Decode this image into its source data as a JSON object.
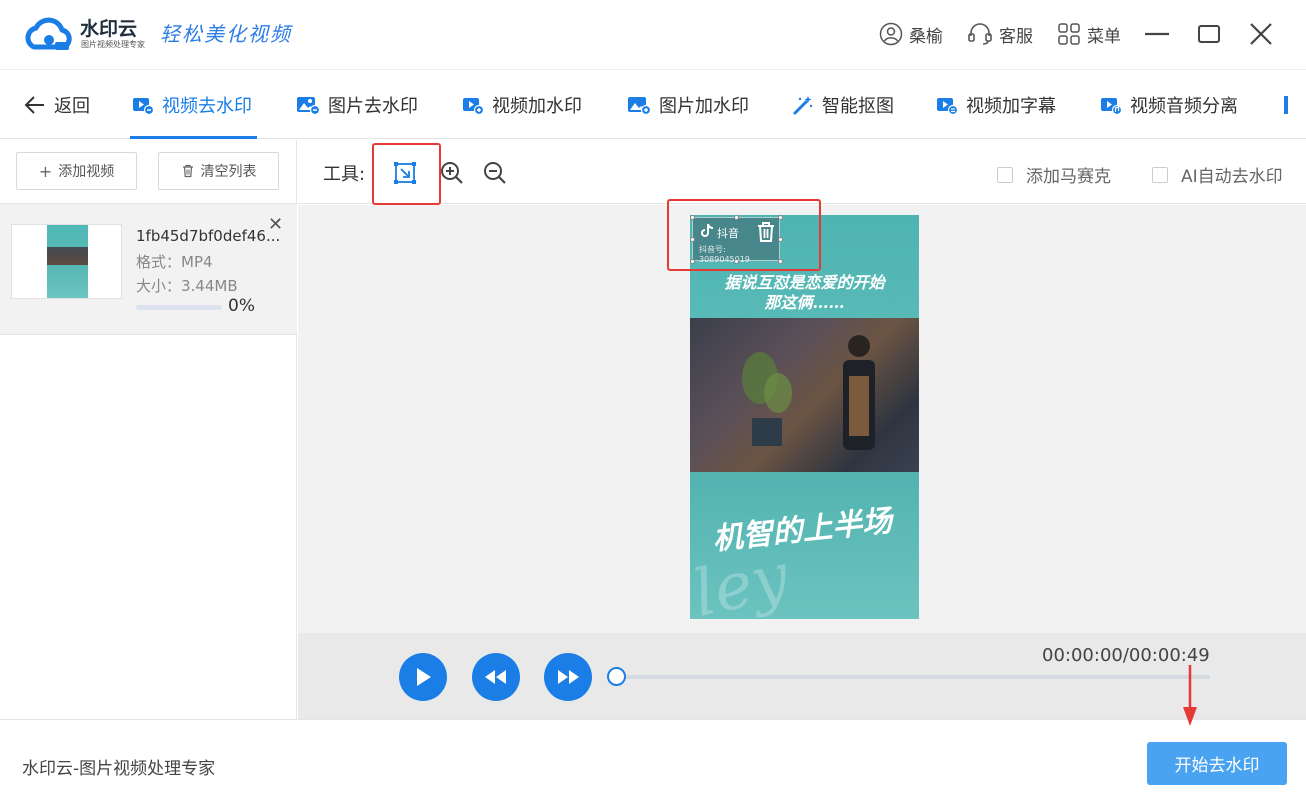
{
  "app": {
    "brand_name": "水印云",
    "brand_sub": "图片视频处理专家",
    "slogan": "轻松美化视频"
  },
  "titlebar": {
    "user_label": "桑榆",
    "service_label": "客服",
    "menu_label": "菜单"
  },
  "tabs": {
    "back_label": "返回",
    "items": [
      {
        "label": "视频去水印",
        "active": true
      },
      {
        "label": "图片去水印",
        "active": false
      },
      {
        "label": "视频加水印",
        "active": false
      },
      {
        "label": "图片加水印",
        "active": false
      },
      {
        "label": "智能抠图",
        "active": false
      },
      {
        "label": "视频加字幕",
        "active": false
      },
      {
        "label": "视频音频分离",
        "active": false
      }
    ]
  },
  "sidebar": {
    "add_video_label": "添加视频",
    "clear_list_label": "清空列表",
    "file": {
      "name": "1fb45d7bf0def46...",
      "format_label": "格式：MP4",
      "size_label": "大小：3.44MB",
      "progress_text": "0%",
      "progress": 0.0
    }
  },
  "toolbar": {
    "tools_label": "工具:",
    "mosaic_label": "添加马赛克",
    "ai_label": "AI自动去水印"
  },
  "video": {
    "watermark_app": "抖音",
    "watermark_id": "抖音号: 3089045019",
    "caption_line1": "据说互怼是恋爱的开始",
    "caption_line2": "那这俩……",
    "big_title": "机智的上半场",
    "script_text": "ley our"
  },
  "player": {
    "time": "00:00:00/00:00:49",
    "seek_fraction": 0.0
  },
  "footer": {
    "text": "水印云-图片视频处理专家",
    "start_label": "开始去水印"
  },
  "colors": {
    "accent": "#1a7ee6",
    "start_button": "#4aa3f0",
    "highlight": "#e53935"
  }
}
